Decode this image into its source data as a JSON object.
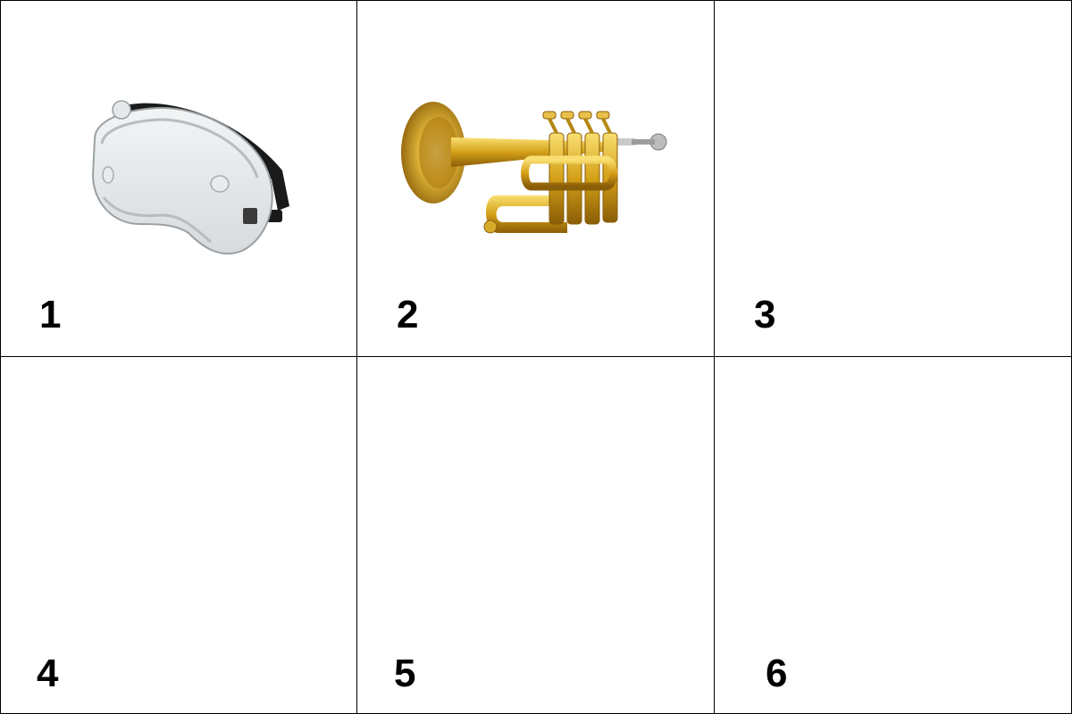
{
  "cells": [
    {
      "label": "1",
      "image": "safety-goggles"
    },
    {
      "label": "2",
      "image": "piccolo-trumpet"
    },
    {
      "label": "3",
      "image": "blank"
    },
    {
      "label": "4",
      "image": "blank"
    },
    {
      "label": "5",
      "image": "blank"
    },
    {
      "label": "6",
      "image": "blank"
    }
  ],
  "colors": {
    "border": "#000000",
    "background": "#ffffff",
    "brass": "#d4a017",
    "strap": "#1a1a1a"
  }
}
